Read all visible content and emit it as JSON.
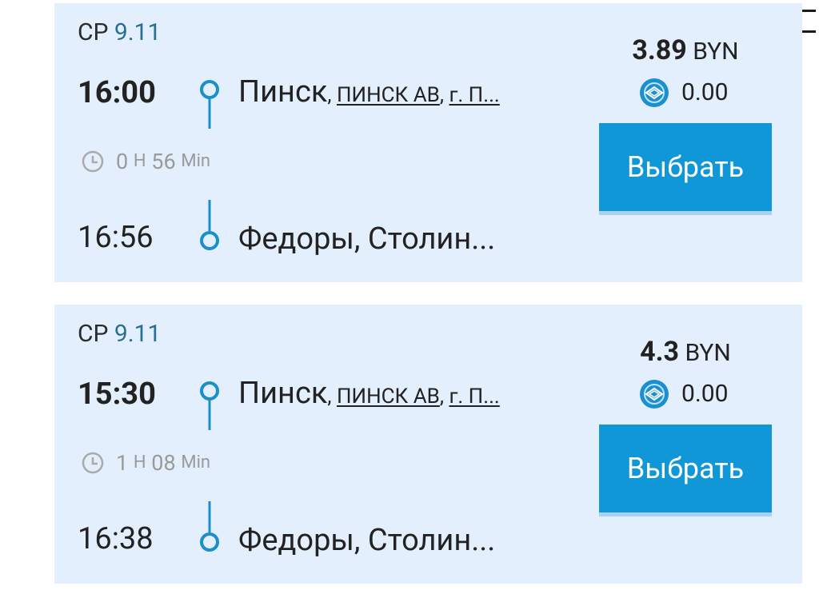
{
  "menu": {
    "icon": "hamburger-menu-icon"
  },
  "trips": [
    {
      "date": {
        "day_of_week": "СР",
        "day": "9.11"
      },
      "departure": {
        "time": "16:00",
        "city": "Пинск",
        "details": [
          "ПИНСК АВ",
          "г. П..."
        ]
      },
      "duration": {
        "hours": "0",
        "hours_unit": "Н",
        "minutes": "56",
        "minutes_unit": "Min"
      },
      "arrival": {
        "time": "16:56",
        "place": "Федоры, Столин..."
      },
      "price": {
        "amount": "3.89",
        "currency": "BYN"
      },
      "bonus": {
        "amount": "0.00",
        "icon": "bonus-coin-icon"
      },
      "select_label": "Выбрать"
    },
    {
      "date": {
        "day_of_week": "СР",
        "day": "9.11"
      },
      "departure": {
        "time": "15:30",
        "city": "Пинск",
        "details": [
          "ПИНСК АВ",
          "г. П..."
        ]
      },
      "duration": {
        "hours": "1",
        "hours_unit": "Н",
        "minutes": "08",
        "minutes_unit": "Min"
      },
      "arrival": {
        "time": "16:38",
        "place": "Федоры, Столин..."
      },
      "price": {
        "amount": "4.3",
        "currency": "BYN"
      },
      "bonus": {
        "amount": "0.00",
        "icon": "bonus-coin-icon"
      },
      "select_label": "Выбрать"
    }
  ],
  "colors": {
    "card_background": "#e3effc",
    "accent": "#0f97d8",
    "route_line": "#1a8fc9",
    "date_number": "#2a6f92",
    "muted_text": "#9c9c9c"
  }
}
